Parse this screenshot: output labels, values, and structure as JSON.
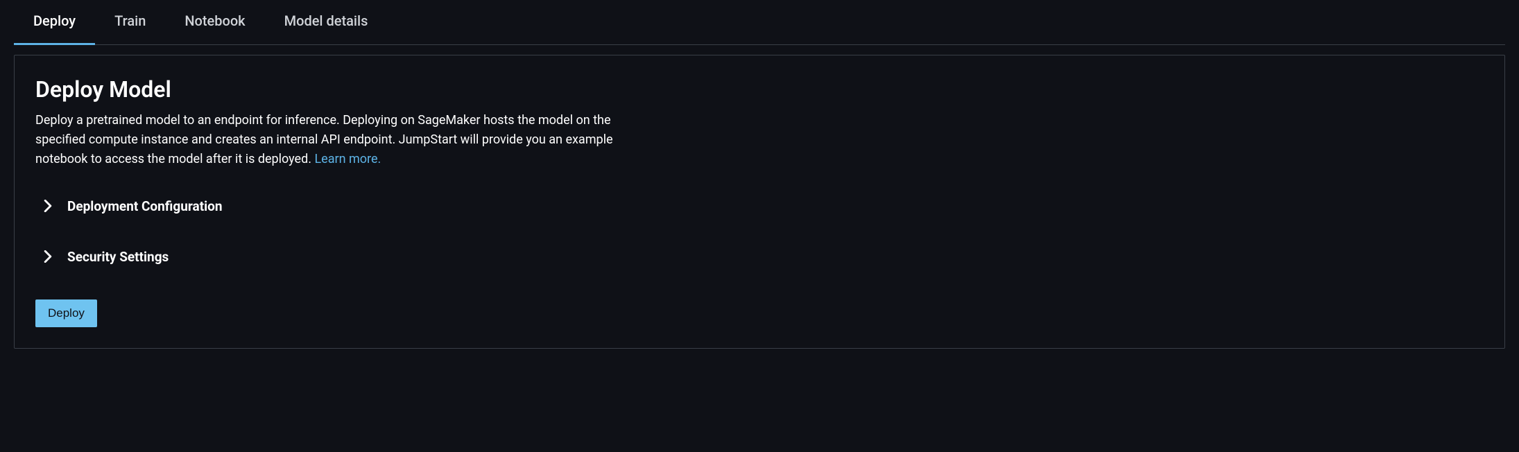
{
  "tabs": {
    "deploy": "Deploy",
    "train": "Train",
    "notebook": "Notebook",
    "model_details": "Model details"
  },
  "panel": {
    "title": "Deploy Model",
    "description": "Deploy a pretrained model to an endpoint for inference. Deploying on SageMaker hosts the model on the specified compute instance and creates an internal API endpoint. JumpStart will provide you an example notebook to access the model after it is deployed. ",
    "learn_more": "Learn more."
  },
  "accordions": {
    "deployment_config": "Deployment Configuration",
    "security_settings": "Security Settings"
  },
  "actions": {
    "deploy_button": "Deploy"
  }
}
